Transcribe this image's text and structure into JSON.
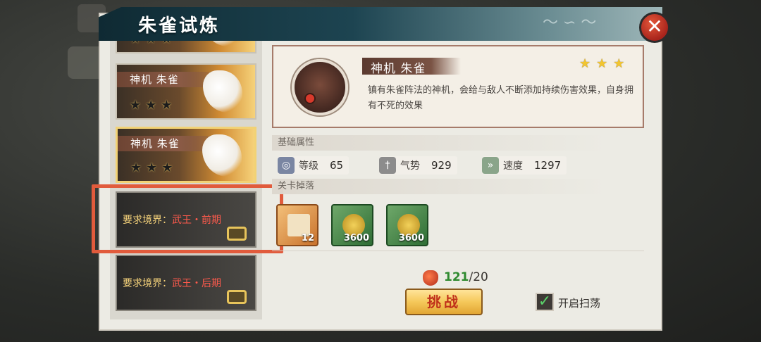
{
  "header": {
    "title": "朱雀试炼",
    "close_icon": "✕"
  },
  "list": {
    "cards": [
      {
        "name": "",
        "stars": 3
      },
      {
        "name": "神机 朱雀",
        "stars": 3
      },
      {
        "name": "神机 朱雀",
        "stars": 3,
        "selected": true
      }
    ],
    "locked": [
      {
        "prefix": "要求境界：",
        "realm": "武王・前期"
      },
      {
        "prefix": "要求境界：",
        "realm": "武王・后期"
      }
    ]
  },
  "detail": {
    "name": "神机 朱雀",
    "stars": 3,
    "description": "镇有朱雀阵法的神机，会给与敌人不断添加持续伤害效果，自身拥有不死的效果"
  },
  "sections": {
    "base_attrs": "基础属性",
    "drops": "关卡掉落"
  },
  "stats": [
    {
      "label": "等级",
      "value": "65",
      "icon": "swirl-icon"
    },
    {
      "label": "气势",
      "value": "929",
      "icon": "sword-icon"
    },
    {
      "label": "速度",
      "value": "1297",
      "icon": "boot-icon"
    }
  ],
  "drops": [
    {
      "name": "scroll-item",
      "count": "12"
    },
    {
      "name": "coin-item",
      "count": "3600"
    },
    {
      "name": "cultivation-item",
      "count": "3600"
    }
  ],
  "energy": {
    "current": "121",
    "max": "/20"
  },
  "buttons": {
    "challenge": "挑战",
    "sweep_label": "开启扫荡",
    "sweep_checked": true
  },
  "colors": {
    "accent_red": "#e15b3c",
    "gold": "#f1c531",
    "realm_red": "#ff5a4c"
  }
}
